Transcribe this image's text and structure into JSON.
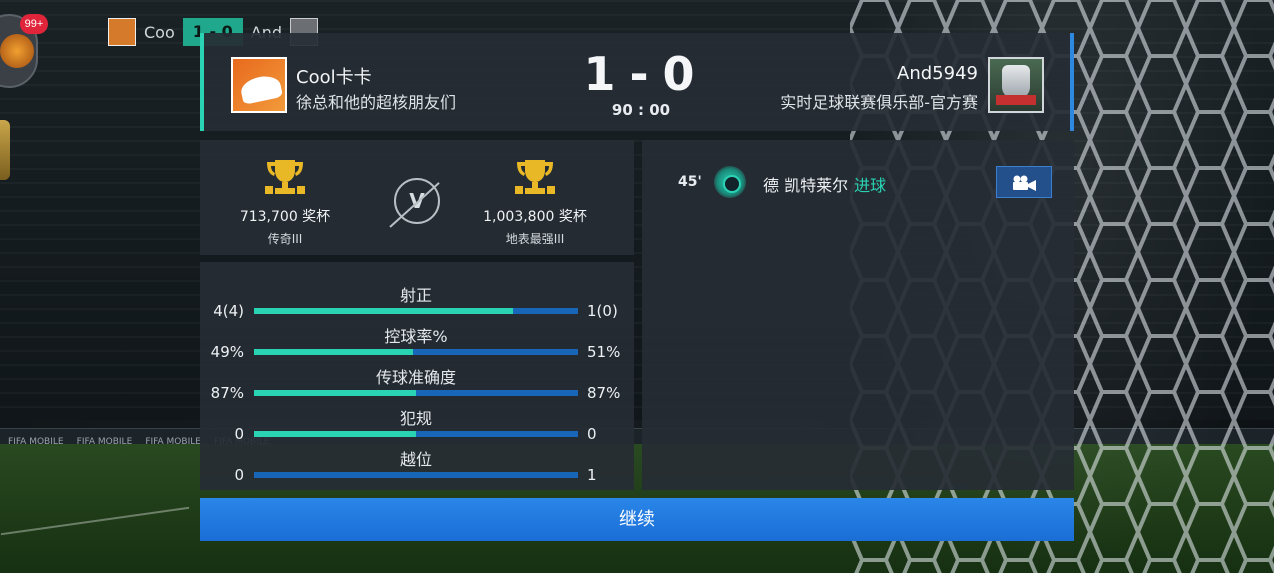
{
  "hud": {
    "notification_count": "99+",
    "mini_scoreboard": {
      "home_short": "Coo",
      "score": "1 - 0",
      "away_short": "And"
    }
  },
  "header": {
    "home": {
      "name": "Cool卡卡",
      "club": "徐总和他的超核朋友们",
      "logo_icon": "cartoon-footballer-logo-icon"
    },
    "away": {
      "name": "And5949",
      "club": "实时足球联赛俱乐部-官方赛",
      "logo_icon": "knight-helmet-badge-icon"
    },
    "score": {
      "home": "1",
      "separator": "-",
      "away": "0"
    },
    "time": "90 : 00"
  },
  "trophies": {
    "home": {
      "points": "713,700 奖杯",
      "rank": "传奇III"
    },
    "vs_label": "V",
    "away": {
      "points": "1,003,800 奖杯",
      "rank": "地表最强III"
    }
  },
  "stats": [
    {
      "label": "射正",
      "home": "4(4)",
      "away": "1(0)",
      "home_share": 0.8
    },
    {
      "label": "控球率%",
      "home": "49%",
      "away": "51%",
      "home_share": 0.49
    },
    {
      "label": "传球准确度",
      "home": "87%",
      "away": "87%",
      "home_share": 0.5
    },
    {
      "label": "犯规",
      "home": "0",
      "away": "0",
      "home_share": 0.5
    },
    {
      "label": "越位",
      "home": "0",
      "away": "1",
      "home_share": 0.0
    }
  ],
  "events": [
    {
      "minute": "45'",
      "player": "德 凯特莱尔",
      "type": "进球",
      "icon": "football-goal-icon",
      "replay_icon": "video-camera-icon"
    }
  ],
  "continue_label": "继续",
  "colors": {
    "accent_home": "#2ad3b4",
    "accent_away": "#1766b8",
    "button": "#1a6ed6",
    "panel": "#262c34"
  },
  "background": {
    "board_text": "FIFA MOBILE"
  }
}
